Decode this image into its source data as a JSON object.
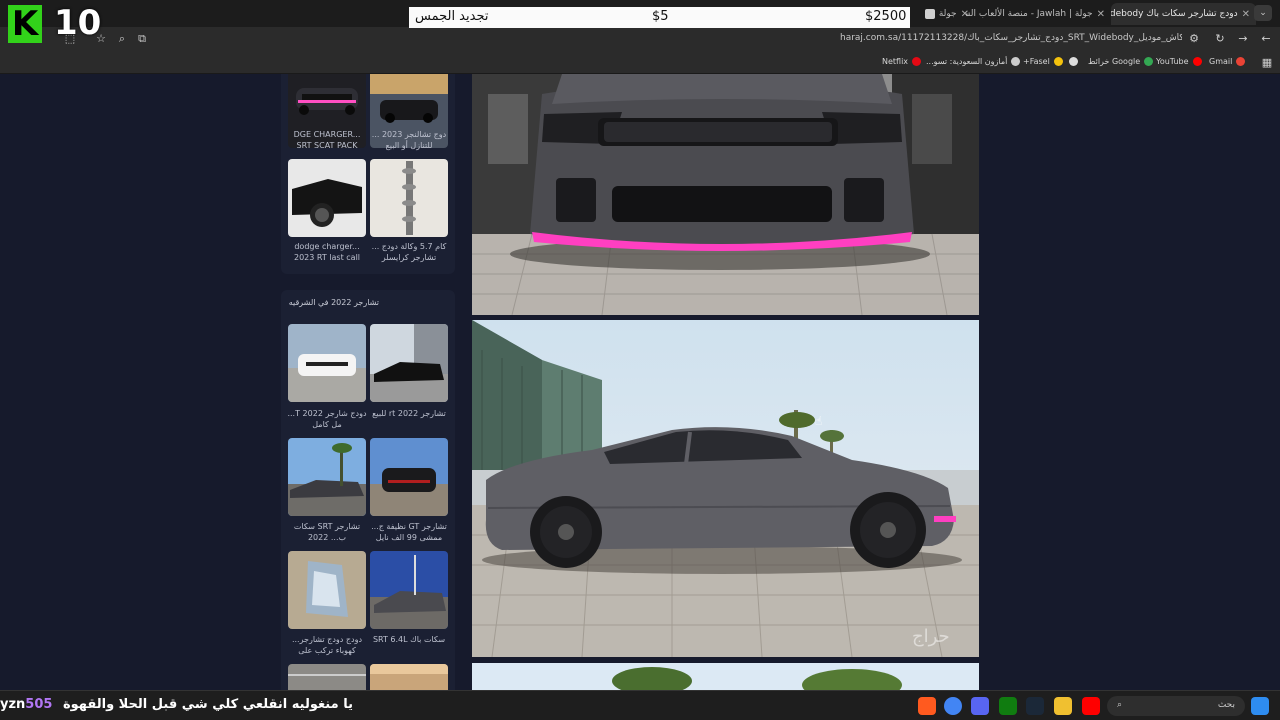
{
  "tabs": [
    {
      "title": "دودج تشارجر سكات باك Widebody",
      "active": true
    },
    {
      "title": "جولة | Jawlah - منصة الألعاب السعودية",
      "active": false
    },
    {
      "title": "جولة",
      "active": false
    }
  ],
  "overlay": {
    "logo_letter": "K",
    "logo_number": "10",
    "donation_amount": "$2500",
    "donation_min": "$5",
    "donation_text": "تجديد الجمس"
  },
  "address": {
    "url": "haraj.com.sa/11172113228/دودج_تشارجر_سكات_باك_SRT_Widebody_للبيع_2023كاش_موديل/"
  },
  "bookmarks": [
    {
      "label": "Gmail",
      "color": "#ea4335"
    },
    {
      "label": "YouTube",
      "color": "#ff0000"
    },
    {
      "label": "Google خرائط",
      "color": "#34a853"
    },
    {
      "label": "",
      "color": "#dddddd"
    },
    {
      "label": "Fasel+",
      "color": "#f4c20d"
    },
    {
      "label": "أمازون السعودية: تسو...",
      "color": "#cccccc"
    },
    {
      "label": "Netflix",
      "color": "#e50914"
    }
  ],
  "sidebar": {
    "top_captions": [
      "DGE CHARGER... SRT SCAT PACK",
      "دوج تشالنجر 2023 ... للتنازل أو البيع",
      "dodge charger... 2023 RT last call",
      "كام 5.7 وكالة دودج ... تشارجر كرايسلر"
    ],
    "section_title": "تشارجر 2022 في الشرقيه",
    "section_captions": [
      "دودج شارجر 2022 T... مل كامل",
      "تشارجر 2022 rt للبيع",
      "تشارجر SRT سكات ب... 2022",
      "تشارجر GT نظيفة ج... ممشى 99 الف نايل",
      "دودج دودج تشارجر... كهوباء تركب على",
      "سكات باك SRT 6.4L"
    ]
  },
  "taskbar": {
    "ticker_name": "yzn",
    "ticker_number": "505",
    "ticker_text": "يا منغوليه انقلعي كلي شي قبل الحلا والقهوة",
    "search_placeholder": "بحث"
  }
}
